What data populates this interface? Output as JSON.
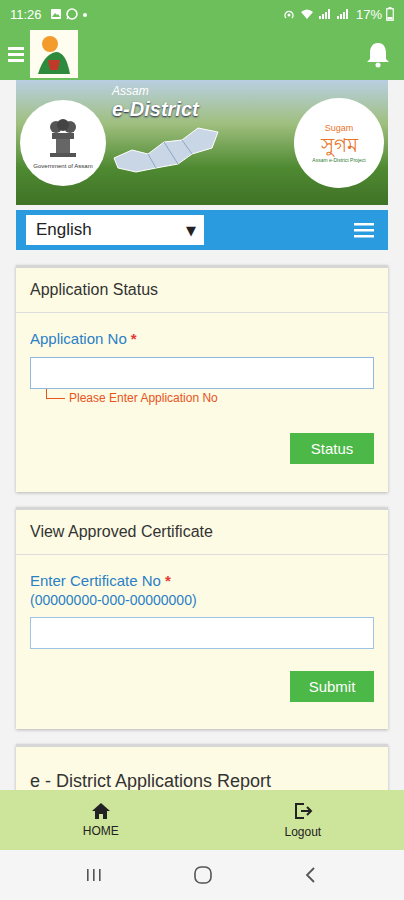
{
  "status_bar": {
    "time": "11:26",
    "battery": "17%"
  },
  "banner": {
    "title_small": "Assam",
    "title": "e-District",
    "emblem_caption": "Government of Assam",
    "logo_latin": "Sugam",
    "logo_bengali": "সুগম",
    "logo_caption": "Assam e-District Project"
  },
  "language": {
    "value": "English",
    "arrow": "▼"
  },
  "application_status": {
    "title": "Application Status",
    "label": "Application No",
    "required": "*",
    "value": "",
    "error": "Please Enter Application No",
    "button": "Status"
  },
  "certificate": {
    "title": "View Approved Certificate",
    "label": "Enter Certificate No",
    "required": "*",
    "hint": "(00000000-000-00000000)",
    "value": "",
    "button": "Submit"
  },
  "report": {
    "title": "e - District Applications Report"
  },
  "bottom_nav": [
    {
      "label": "HOME",
      "kind": "home"
    },
    {
      "label": "Logout",
      "kind": "logout"
    }
  ]
}
